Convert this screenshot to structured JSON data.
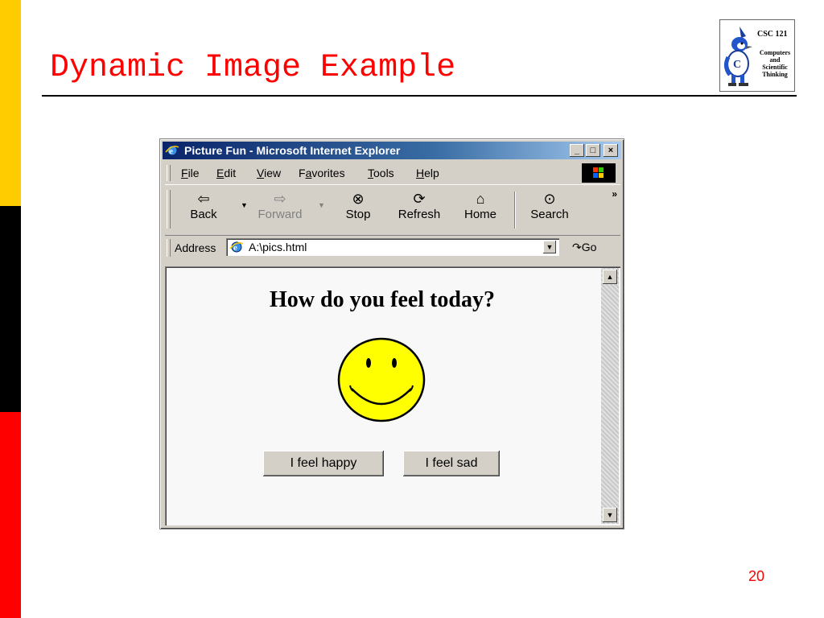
{
  "slide": {
    "title": "Dynamic Image Example",
    "page_number": "20",
    "logo": {
      "line1": "CSC 121",
      "line2": "Computers",
      "line3": "and",
      "line4": "Scientific",
      "line5": "Thinking"
    },
    "stripe_colors": [
      "#ffcc00",
      "#000000",
      "#ff0000"
    ]
  },
  "window": {
    "title": "Picture Fun - Microsoft Internet Explorer",
    "controls": {
      "minimize": "_",
      "maximize": "□",
      "close": "×"
    },
    "menu": [
      {
        "label": "File",
        "accel": "F",
        "rest": "ile"
      },
      {
        "label": "Edit",
        "accel": "E",
        "rest": "dit"
      },
      {
        "label": "View",
        "accel": "V",
        "rest": "iew"
      },
      {
        "label": "Favorites",
        "pre": "F",
        "accel": "a",
        "rest": "vorites"
      },
      {
        "label": "Tools",
        "accel": "T",
        "rest": "ools"
      },
      {
        "label": "Help",
        "accel": "H",
        "rest": "elp"
      }
    ],
    "toolbar": {
      "back": "Back",
      "forward": "Forward",
      "stop": "Stop",
      "refresh": "Refresh",
      "home": "Home",
      "search": "Search",
      "more": "»"
    },
    "address": {
      "label": "Address",
      "value": "A:\\pics.html",
      "go": "Go"
    }
  },
  "page": {
    "question": "How do you feel today?",
    "buttons": {
      "happy": "I feel happy",
      "sad": "I feel sad"
    },
    "smiley_color": "#ffff00"
  }
}
